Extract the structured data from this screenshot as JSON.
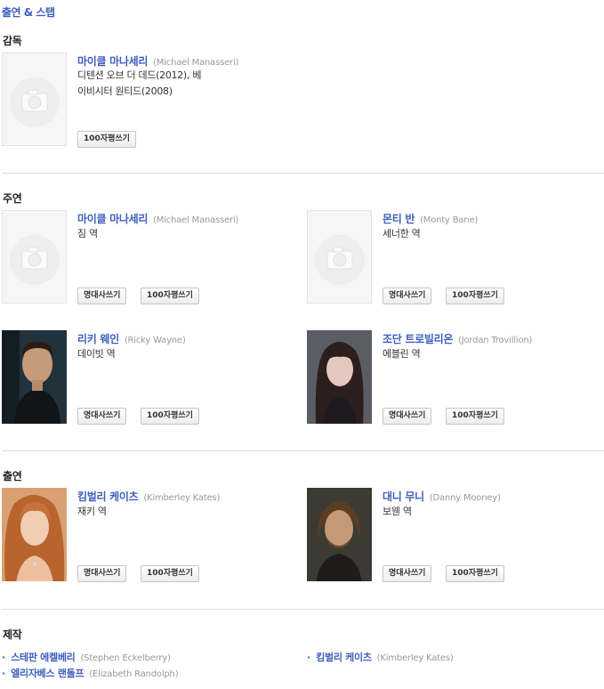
{
  "title": "출연 & 스탭",
  "sections": {
    "director": "감독",
    "lead": "주연",
    "cast": "출연",
    "production": "제작"
  },
  "buttons": {
    "quote": "명대사쓰기",
    "review": "100자평쓰기"
  },
  "director": {
    "name": "마이클 마나세리",
    "eng": "(Michael Manasseri)",
    "desc1": "디텐션 오브 더 데드(2012), 베",
    "desc2": "이비시터 원티드(2008)"
  },
  "lead": [
    {
      "name": "마이클 마나세리",
      "eng": "(Michael Manasseri)",
      "role": "짐 역",
      "photo": "placeholder-camera-icon"
    },
    {
      "name": "몬티 반",
      "eng": "(Monty Bane)",
      "role": "세너한 역",
      "photo": "placeholder-camera-icon"
    },
    {
      "name": "리키 웨인",
      "eng": "(Ricky Wayne)",
      "role": "데이빗 역",
      "photo": "actor-photo"
    },
    {
      "name": "조단 트로빌리온",
      "eng": "(Jordan Trovillion)",
      "role": "에블린 역",
      "photo": "actress-photo"
    }
  ],
  "cast": [
    {
      "name": "킴벌리 케이츠",
      "eng": "(Kimberley Kates)",
      "role": "재키 역",
      "photo": "actress-photo"
    },
    {
      "name": "대니 무니",
      "eng": "(Danny Mooney)",
      "role": "보웬 역",
      "photo": "actor-photo"
    }
  ],
  "production": [
    {
      "name": "스테판 에켈베리",
      "eng": "(Stephen Eckelberry)"
    },
    {
      "name": "킴벌리 케이츠",
      "eng": "(Kimberley Kates)"
    },
    {
      "name": "엘리자베스 랜돌프",
      "eng": "(Elizabeth Randolph)"
    }
  ]
}
